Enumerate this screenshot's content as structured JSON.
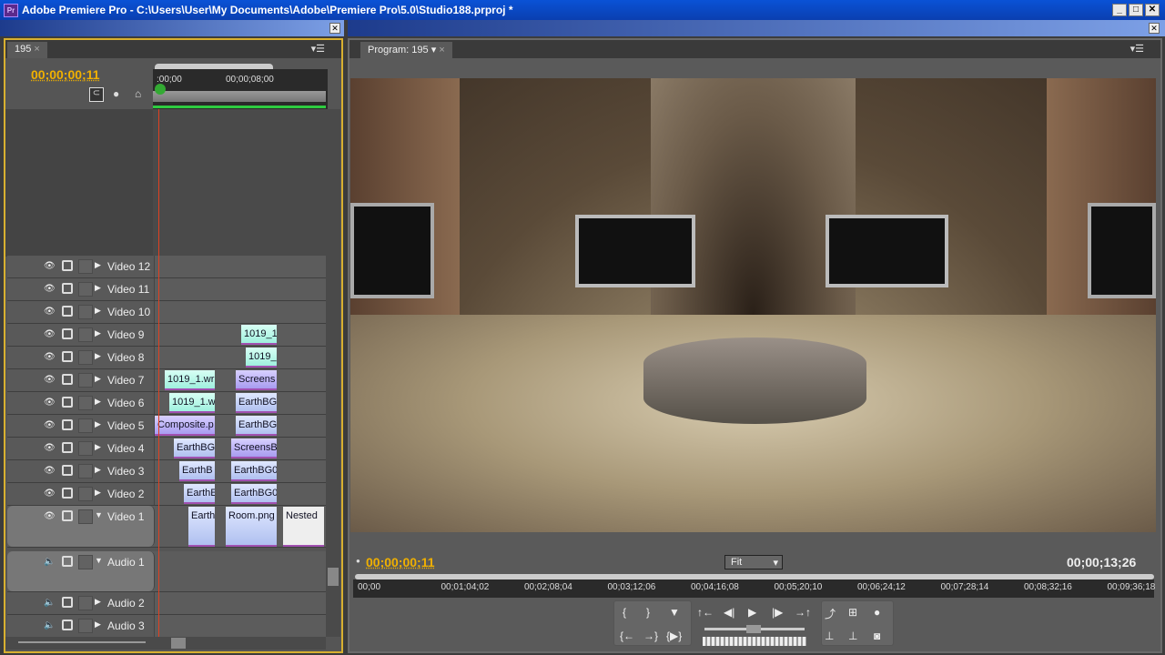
{
  "window": {
    "title": "Adobe Premiere Pro - C:\\Users\\User\\My Documents\\Adobe\\Premiere Pro\\5.0\\Studio188.prproj *",
    "logo": "Pr"
  },
  "timeline": {
    "tab": "195",
    "timecode": "00;00;00;11",
    "ruler_labels": [
      ":00;00",
      "00;00;08;00"
    ],
    "video_tracks": [
      {
        "name": "Video 12",
        "clips": []
      },
      {
        "name": "Video 11",
        "clips": []
      },
      {
        "name": "Video 10",
        "clips": []
      },
      {
        "name": "Video 9",
        "clips": [
          {
            "label": "1019_1",
            "color": "cyan"
          }
        ]
      },
      {
        "name": "Video 8",
        "clips": [
          {
            "label": "1019_",
            "color": "cyan"
          }
        ]
      },
      {
        "name": "Video 7",
        "clips": [
          {
            "label": "1019_1.wr",
            "color": "cyan"
          },
          {
            "label": "Screens",
            "color": "purple"
          }
        ]
      },
      {
        "name": "Video 6",
        "clips": [
          {
            "label": "1019_1.w",
            "color": "cyan"
          },
          {
            "label": "EarthBG",
            "color": "lav"
          }
        ]
      },
      {
        "name": "Video 5",
        "clips": [
          {
            "label": "Composite.p",
            "color": "purple"
          },
          {
            "label": "EarthBG",
            "color": "lav"
          }
        ]
      },
      {
        "name": "Video 4",
        "clips": [
          {
            "label": "EarthBG",
            "color": "lav"
          },
          {
            "label": "ScreensB",
            "color": "purple"
          }
        ]
      },
      {
        "name": "Video 3",
        "clips": [
          {
            "label": "EarthB",
            "color": "lav"
          },
          {
            "label": "EarthBG0",
            "color": "lav"
          }
        ]
      },
      {
        "name": "Video 2",
        "clips": [
          {
            "label": "EarthE",
            "color": "lav"
          },
          {
            "label": "EarthBG0",
            "color": "lav"
          }
        ]
      },
      {
        "name": "Video 1",
        "clips": [
          {
            "label": "Earth",
            "color": "lav"
          },
          {
            "label": "Room.png",
            "color": "lav"
          },
          {
            "label": "Nested",
            "color": "white"
          }
        ]
      }
    ],
    "audio_tracks": [
      {
        "name": "Audio 1"
      },
      {
        "name": "Audio 2"
      },
      {
        "name": "Audio 3"
      }
    ]
  },
  "program": {
    "tab": "Program: 195",
    "current_time": "00;00;00;11",
    "duration": "00;00;13;26",
    "zoom": "Fit",
    "ruler_labels": [
      "00;00",
      "00;01;04;02",
      "00;02;08;04",
      "00;03;12;06",
      "00;04;16;08",
      "00;05;20;10",
      "00;06;24;12",
      "00;07;28;14",
      "00;08;32;16",
      "00;09;36;18"
    ]
  }
}
